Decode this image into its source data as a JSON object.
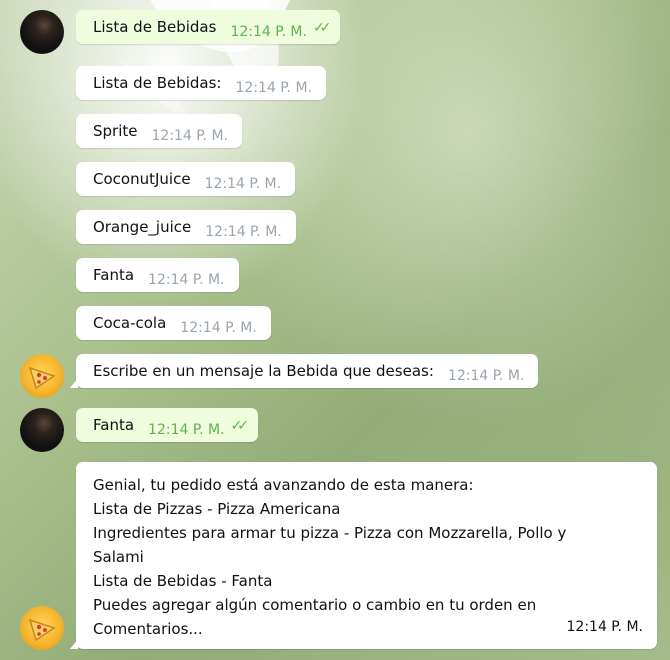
{
  "messages": [
    {
      "text": "Lista de Bebidas",
      "time": "12:14 P. M.",
      "direction": "out",
      "read": true
    },
    {
      "text": "Lista de Bebidas:",
      "time": "12:14 P. M.",
      "direction": "in"
    },
    {
      "text": "Sprite",
      "time": "12:14 P. M.",
      "direction": "in"
    },
    {
      "text": "CoconutJuice",
      "time": "12:14 P. M.",
      "direction": "in"
    },
    {
      "text": "Orange_juice",
      "time": "12:14 P. M.",
      "direction": "in"
    },
    {
      "text": "Fanta",
      "time": "12:14 P. M.",
      "direction": "in"
    },
    {
      "text": "Coca-cola",
      "time": "12:14 P. M.",
      "direction": "in"
    },
    {
      "text": "Escribe en un mensaje la Bebida que deseas:",
      "time": "12:14 P. M.",
      "direction": "in"
    },
    {
      "text": "Fanta",
      "time": "12:14 P. M.",
      "direction": "out",
      "read": true
    },
    {
      "lines": [
        "Genial, tu pedido está avanzando de esta manera:",
        "Lista de Pizzas - Pizza Americana",
        "Ingredientes para armar tu pizza - Pizza con Mozzarella, Pollo y",
        "Salami",
        "Lista de Bebidas - Fanta",
        "Puedes agregar algún comentario o cambio en tu orden en",
        "Comentarios..."
      ],
      "time": "12:14 P. M.",
      "direction": "in"
    }
  ],
  "avatars": {
    "user": "user-photo-avatar",
    "bot": "pizza-icon"
  },
  "colors": {
    "outgoing_bubble": "#effdde",
    "incoming_bubble": "#ffffff",
    "read_checks": "#5db34c",
    "time_incoming": "#9aa4ad"
  }
}
